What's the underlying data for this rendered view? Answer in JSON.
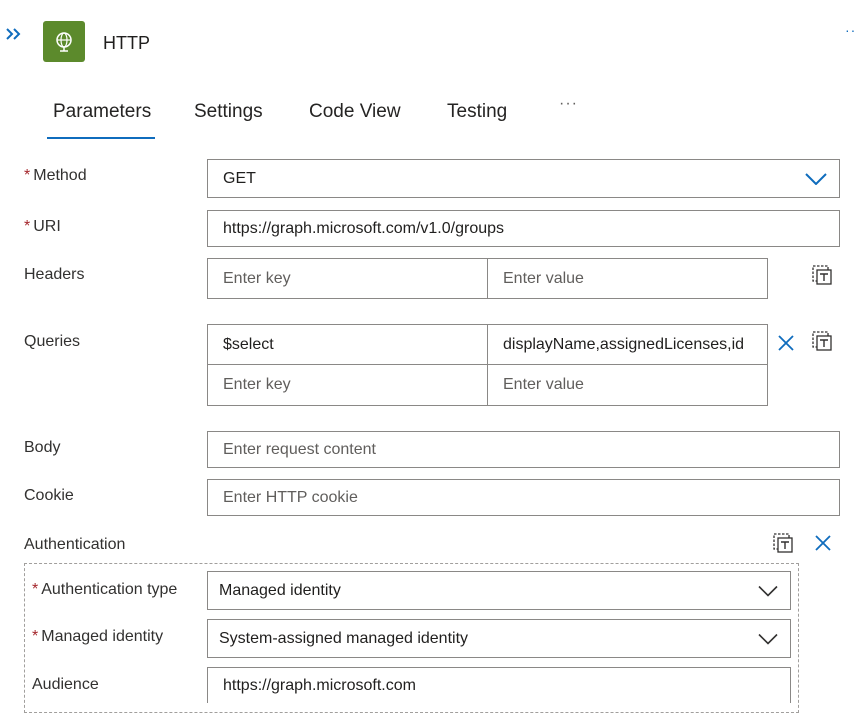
{
  "header": {
    "title": "HTTP",
    "expand_icon": "double-chevron-right-icon",
    "app_icon": "globe-icon",
    "more_label": "··"
  },
  "tabs": [
    {
      "label": "Parameters",
      "selected": true
    },
    {
      "label": "Settings"
    },
    {
      "label": "Code View"
    },
    {
      "label": "Testing"
    }
  ],
  "tabs_more": "···",
  "form": {
    "method": {
      "label": "Method",
      "required": true,
      "value": "GET"
    },
    "uri": {
      "label": "URI",
      "required": true,
      "value": "https://graph.microsoft.com/v1.0/groups"
    },
    "headers": {
      "label": "Headers",
      "key_placeholder": "Enter key",
      "value_placeholder": "Enter value"
    },
    "queries": {
      "label": "Queries",
      "rows": [
        {
          "key": "$select",
          "value": "displayName,assignedLicenses,id"
        }
      ],
      "key_placeholder": "Enter key",
      "value_placeholder": "Enter value"
    },
    "body": {
      "label": "Body",
      "placeholder": "Enter request content"
    },
    "cookie": {
      "label": "Cookie",
      "placeholder": "Enter HTTP cookie"
    },
    "authentication": {
      "label": "Authentication",
      "type": {
        "label": "Authentication type",
        "required": true,
        "value": "Managed identity"
      },
      "identity": {
        "label": "Managed identity",
        "required": true,
        "value": "System-assigned managed identity"
      },
      "audience": {
        "label": "Audience",
        "value": "https://graph.microsoft.com"
      }
    }
  },
  "required_marker": "*",
  "colors": {
    "accent": "#0f6cbd",
    "app_icon_bg": "#5c8a2c",
    "required": "#a4262c"
  }
}
